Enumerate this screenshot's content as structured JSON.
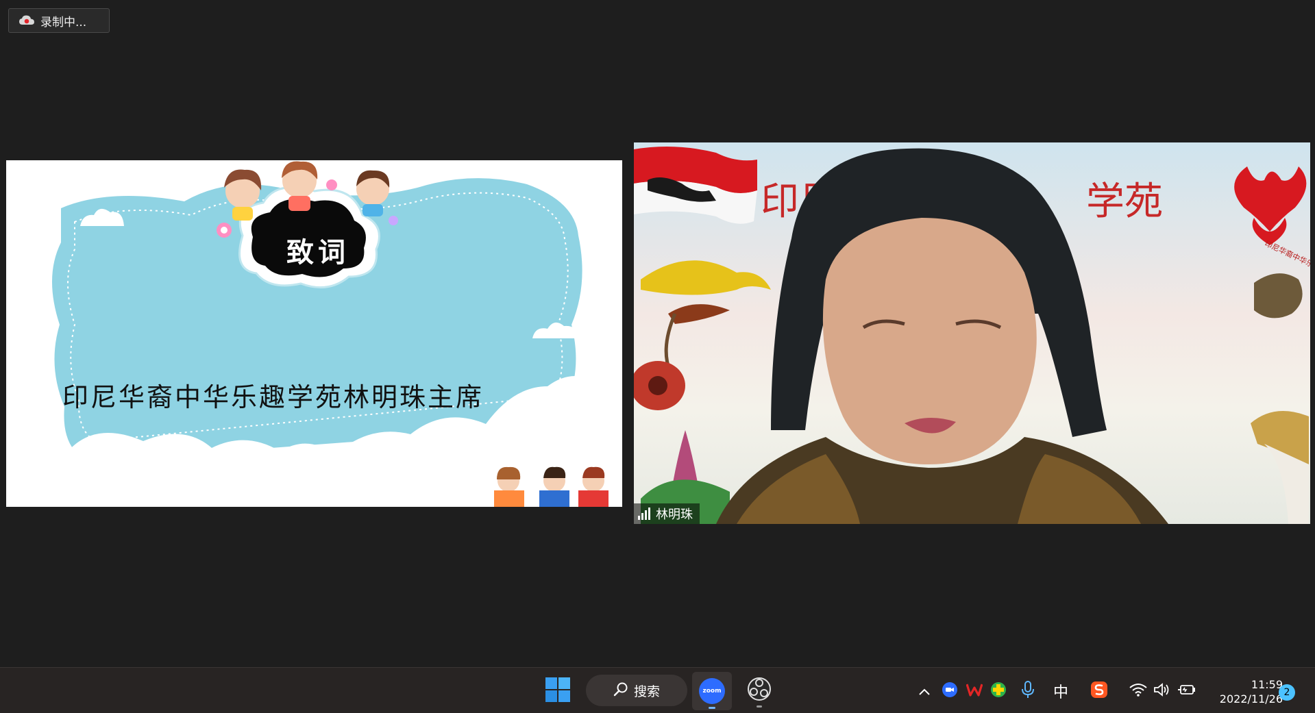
{
  "recording": {
    "label": "录制中..."
  },
  "slide": {
    "heading": "致词",
    "title": "印尼华裔中华乐趣学苑林明珠主席"
  },
  "video": {
    "participant_name": "林明珠",
    "background_text_left": "印尼",
    "background_text_right": "学苑",
    "logo_text": "印尼华裔中华乐趣学苑"
  },
  "taskbar": {
    "search_label": "搜索",
    "zoom_label": "zoom",
    "ime_label": "中",
    "time": "11:59",
    "date": "2022/11/26",
    "notification_count": "2"
  },
  "icons": {
    "start": "windows-start-icon",
    "search": "search-icon",
    "zoom": "zoom-icon",
    "obs": "obs-icon",
    "tray_chevron": "chevron-up-icon",
    "wps": "wps-icon",
    "wifi": "wifi-icon",
    "volume": "volume-icon",
    "battery": "battery-icon",
    "mic": "microphone-icon"
  },
  "colors": {
    "zoom_blue": "#2d6cff",
    "slide_frame_blue": "#8fd3e3",
    "notification_blue": "#4cc2ff",
    "taskbar_bg": "#282423"
  }
}
